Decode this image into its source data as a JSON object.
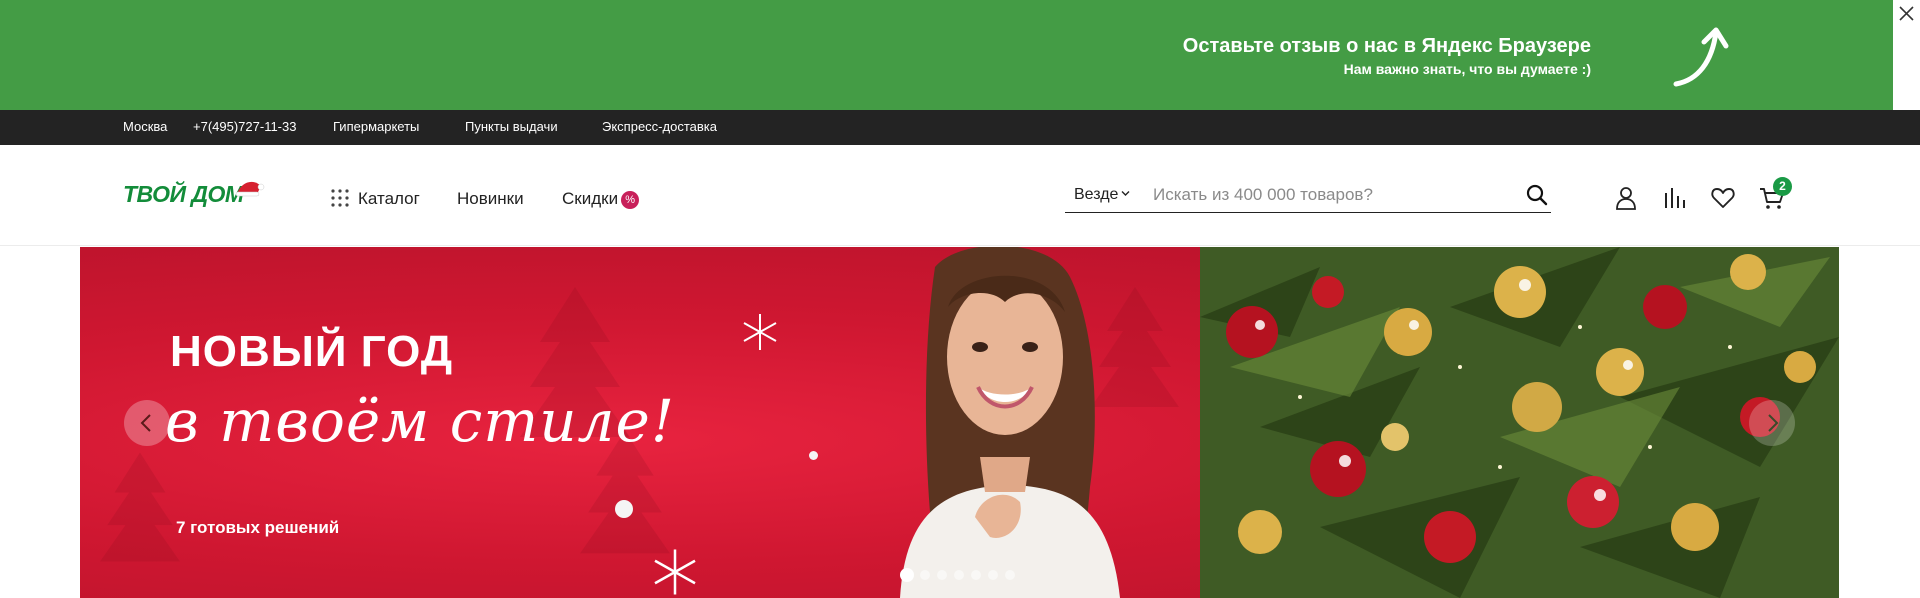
{
  "promo": {
    "title": "Оставьте отзыв о нас в Яндекс Браузере",
    "subtitle": "Нам важно знать, что вы думаете :)",
    "arrow_icon": "arrow-up-right-icon",
    "close_icon": "close-icon",
    "background": "#449c45"
  },
  "topbar": {
    "city": "Москва",
    "phone": "+7(495)727-11-33",
    "links": [
      "Гипермаркеты",
      "Пункты выдачи",
      "Экспресс-доставка"
    ],
    "background": "#232323"
  },
  "header": {
    "logo": "ТВОЙ ДОМ",
    "nav": {
      "catalog": "Каталог",
      "new": "Новинки",
      "sale": "Скидки",
      "sale_badge": "%"
    },
    "search": {
      "scope": "Везде",
      "placeholder": "Искать из 400 000 товаров?"
    },
    "icons": [
      "user-icon",
      "compare-icon",
      "heart-icon",
      "cart-icon"
    ],
    "cart_count": "2",
    "brand_color": "#138c3a",
    "sale_color": "#c8205a"
  },
  "banner": {
    "title": "НОВЫЙ ГОД",
    "script": "в твоём стиле!",
    "subtitle": "7 готовых решений",
    "slides_total": 7,
    "active_slide": 1
  }
}
